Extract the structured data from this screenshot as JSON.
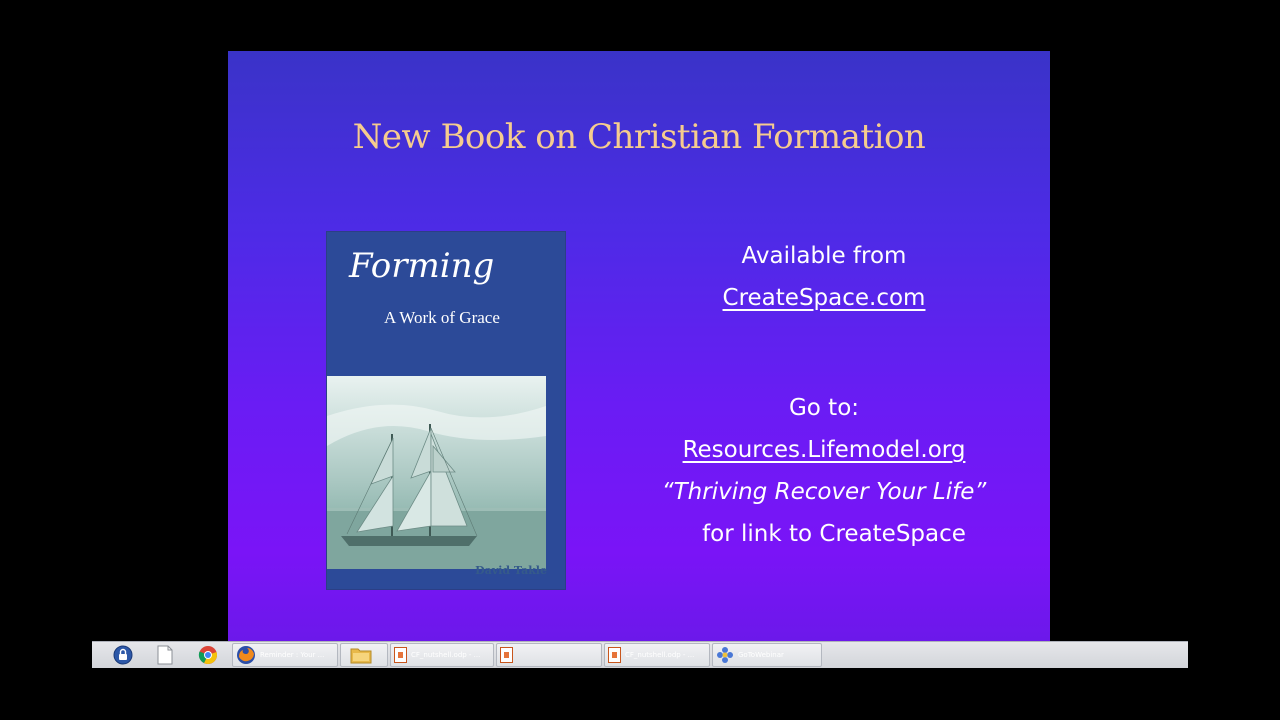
{
  "slide": {
    "title": "New Book on Christian Formation",
    "book": {
      "title": "Forming",
      "subtitle": "A Work of Grace",
      "author": "David Takle"
    },
    "available_from": "Available from",
    "available_link": "CreateSpace.com",
    "go_to": "Go to:",
    "resources_link": "Resources.Lifemodel.org",
    "quote": "“Thriving Recover Your Life”",
    "for_link": "for link to CreateSpace"
  },
  "taskbar": {
    "buttons": [
      {
        "label": "Reminder : Your ...",
        "icon": "firefox-icon"
      },
      {
        "label": "",
        "icon": "folder-icon"
      },
      {
        "label": "CF_nutshell.odp - ...",
        "icon": "impress-icon"
      },
      {
        "label": "",
        "icon": "impress-icon"
      },
      {
        "label": "CF_nutshell.odp - ...",
        "icon": "impress-icon"
      },
      {
        "label": "GoToWebinar",
        "icon": "gotowebinar-icon"
      }
    ]
  },
  "colors": {
    "title": "#f6cc8e",
    "cover": "#2c4a98",
    "slide_top": "#3a33c8",
    "slide_bottom": "#7a14f7"
  }
}
